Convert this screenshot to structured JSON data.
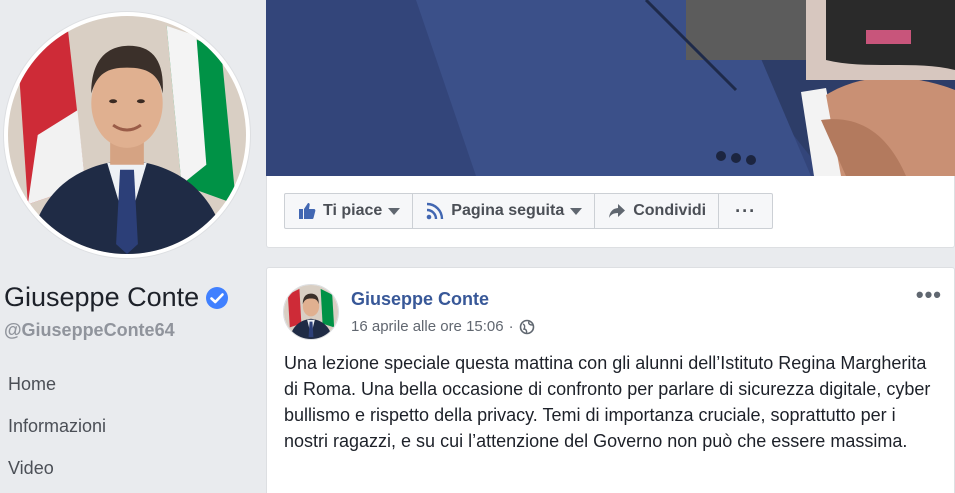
{
  "profile": {
    "name": "Giuseppe Conte",
    "handle": "@GiuseppeConte64",
    "verified": true
  },
  "nav": {
    "items": [
      {
        "label": "Home"
      },
      {
        "label": "Informazioni"
      },
      {
        "label": "Video"
      }
    ]
  },
  "actions": {
    "like_label": "Ti piace",
    "follow_label": "Pagina seguita",
    "share_label": "Condividi",
    "more_label": "···"
  },
  "post": {
    "author": "Giuseppe Conte",
    "timestamp": "16 aprile alle ore 15:06",
    "separator": "·",
    "menu_label": "•••",
    "text": "Una lezione speciale questa mattina con gli alunni dell’Istituto Regina Margherita di Roma. Una bella occasione di confronto per parlare di sicurezza digitale, cyber bullismo e rispetto della privacy. Temi di importanza cruciale, soprattutto per i nostri ragazzi, e su cui l’attenzione del Governo non può che essere massima."
  },
  "colors": {
    "link_blue": "#385898",
    "verified_blue": "#4080ff",
    "background": "#e9ebee",
    "flag_green": "#009246",
    "flag_red": "#ce2b37"
  },
  "icons": [
    "verified-badge-icon",
    "thumbs-up-icon",
    "rss-feed-icon",
    "share-arrow-icon",
    "globe-icon",
    "ellipsis-icon",
    "caret-down-icon"
  ]
}
